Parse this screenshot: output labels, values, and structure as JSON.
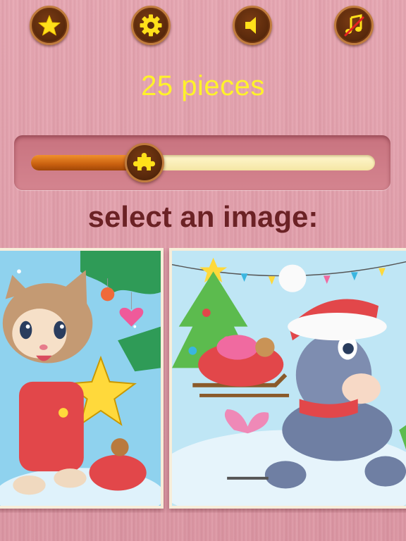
{
  "toolbar": {
    "buttons": [
      {
        "id": "star",
        "icon": "star-icon"
      },
      {
        "id": "settings",
        "icon": "gear-icon"
      },
      {
        "id": "sound",
        "icon": "speaker-icon"
      },
      {
        "id": "music",
        "icon": "music-muted-icon"
      }
    ],
    "icon_color": "#ffe01a"
  },
  "pieces_label": "25 pieces",
  "slider": {
    "level_fraction": 0.33,
    "knob_icon": "puzzle-piece-icon"
  },
  "select_label": "select an image:",
  "images": [
    {
      "id": "image-kitten-christmas"
    },
    {
      "id": "image-donkey-sleigh"
    }
  ],
  "colors": {
    "label_yellow": "#fff22a",
    "title_maroon": "#6b2225",
    "button_brown": "#5b2a0c"
  }
}
